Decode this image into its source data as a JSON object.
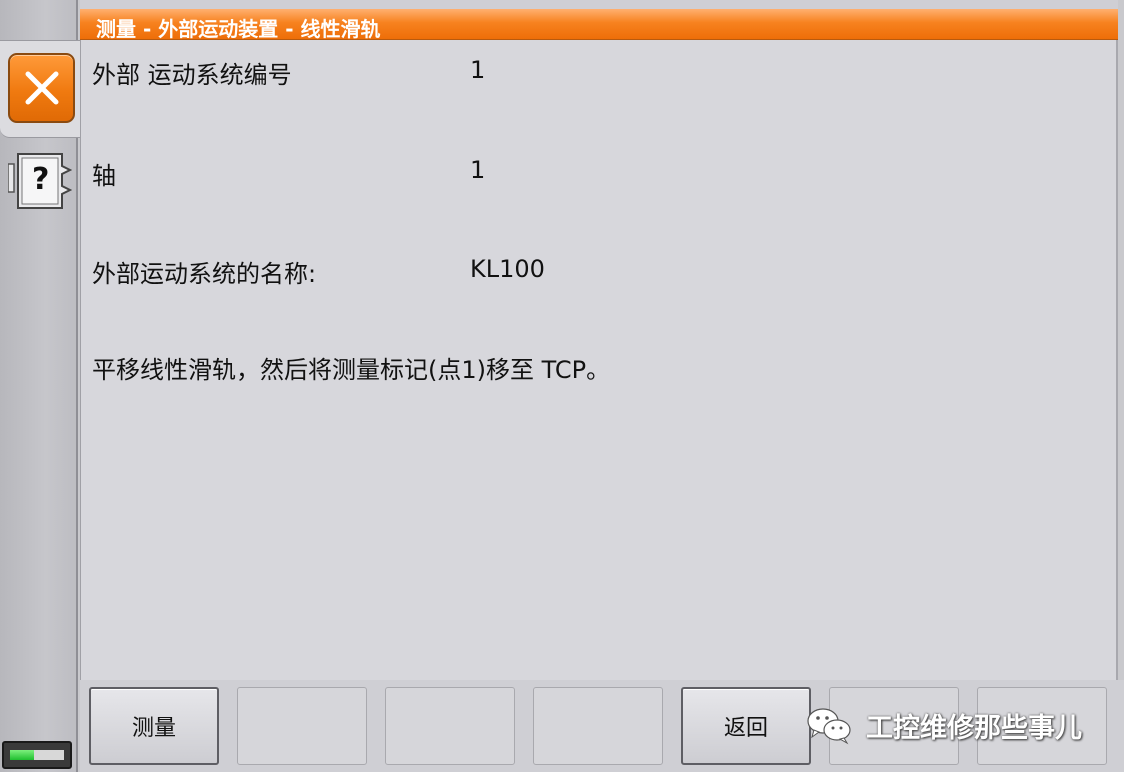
{
  "window": {
    "title": "测量 - 外部运动装置 - 线性滑轨"
  },
  "sidebar": {
    "close_icon": "close-x-icon",
    "help_icon": "help-question-icon",
    "help_glyph": "?",
    "battery_level": 0.45
  },
  "fields": [
    {
      "label": "外部 运动系统编号",
      "value": "1"
    },
    {
      "label": "轴",
      "value": "1"
    },
    {
      "label": "外部运动系统的名称:",
      "value": "KL100"
    }
  ],
  "instruction": "平移线性滑轨，然后将测量标记(点1)移至 TCP。",
  "softkeys": [
    {
      "label": "测量",
      "enabled": true
    },
    {
      "label": "",
      "enabled": false
    },
    {
      "label": "",
      "enabled": false
    },
    {
      "label": "",
      "enabled": false
    },
    {
      "label": "返回",
      "enabled": true
    },
    {
      "label": "",
      "enabled": false
    },
    {
      "label": "",
      "enabled": false
    }
  ],
  "watermark": {
    "text": "工控维修那些事儿",
    "icon": "wechat-icon"
  },
  "colors": {
    "accent_orange": "#f07a10",
    "panel_gray": "#d7d7dc",
    "battery_green": "#1fbf2f"
  }
}
